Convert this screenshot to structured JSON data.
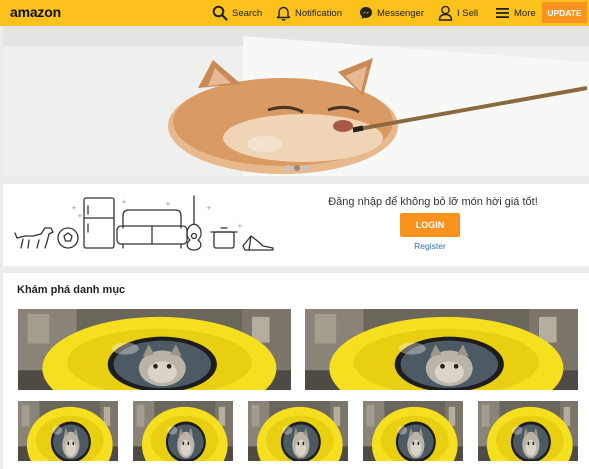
{
  "header": {
    "logo": "amazon",
    "nav": [
      {
        "label": "Search",
        "icon": "search-icon"
      },
      {
        "label": "Notification",
        "icon": "bell-icon"
      },
      {
        "label": "Messenger",
        "icon": "messenger-icon"
      },
      {
        "label": "I Sell",
        "icon": "user-icon"
      },
      {
        "label": "More",
        "icon": "menu-icon"
      }
    ],
    "update_label": "UPDATE"
  },
  "banner": {
    "slides": 3,
    "active_slide": 2
  },
  "promo": {
    "text": "Đăng nhập để không bỏ lỡ món hời giá tốt!",
    "login_label": "LOGIN",
    "register_label": "Register"
  },
  "categories": {
    "title": "Khám phá danh mục"
  },
  "colors": {
    "brand_yellow": "#fcc21c",
    "accent_orange": "#f7931e",
    "link_blue": "#2a6fb3"
  }
}
